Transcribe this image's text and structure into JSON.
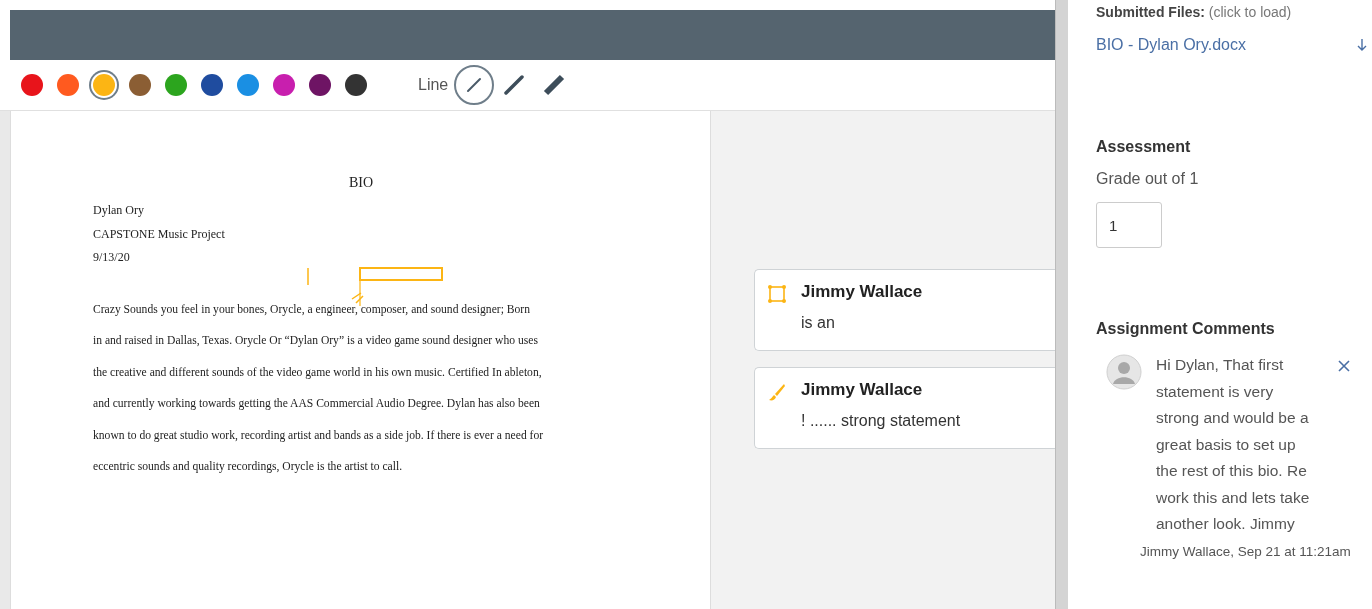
{
  "toolbar": {
    "colors": [
      {
        "color": "#e8141b",
        "selected": false
      },
      {
        "color": "#ff5a1f",
        "selected": false
      },
      {
        "color": "#fcb514",
        "selected": true
      },
      {
        "color": "#8b5e34",
        "selected": false
      },
      {
        "color": "#2ca51e",
        "selected": false
      },
      {
        "color": "#1f4c9f",
        "selected": false
      },
      {
        "color": "#1a8fe3",
        "selected": false
      },
      {
        "color": "#c81fae",
        "selected": false
      },
      {
        "color": "#6e1464",
        "selected": false
      },
      {
        "color": "#333333",
        "selected": false
      }
    ],
    "line_label": "Line",
    "line_widths": [
      {
        "kind": "none",
        "selected": true
      },
      {
        "kind": "thin",
        "selected": false
      },
      {
        "kind": "thick",
        "selected": false
      }
    ]
  },
  "document": {
    "title": "BIO",
    "author": "Dylan Ory",
    "project": "CAPSTONE Music Project",
    "date": "9/13/20",
    "paragraph_lines": [
      "Crazy Sounds you feel in your bones, Orycle, a engineer, composer, and sound designer; Born",
      "in and raised in Dallas, Texas. Orycle Or “Dylan Ory” is a video game sound designer who uses",
      "the creative and different sounds of the video game world in his own music. Certified In ableton,",
      "and currently working towards getting the AAS Commercial Audio Degree. Dylan has also been",
      "known to do great studio work, recording artist and bands as a side job. If there is ever a need for",
      "eccentric sounds and quality recordings, Orycle is the artist to call."
    ]
  },
  "annotations": [
    {
      "kind": "area",
      "author": "Jimmy Wallace",
      "text": "is an"
    },
    {
      "kind": "freehand",
      "author": "Jimmy Wallace",
      "text": "! ...... strong statement"
    }
  ],
  "sidebar": {
    "submitted_files_label": "Submitted Files:",
    "submitted_files_hint": "(click to load)",
    "file": "BIO - Dylan Ory.docx",
    "assessment_heading": "Assessment",
    "grade_label": "Grade out of 1",
    "grade_value": "1",
    "comments_heading": "Assignment Comments",
    "comments": [
      {
        "text": "Hi Dylan, That first statement is very strong and would be a great basis to set up the rest of this bio. Re work this and lets take another look. Jimmy",
        "meta": "Jimmy Wallace, Sep 21 at 11:21am"
      }
    ]
  }
}
